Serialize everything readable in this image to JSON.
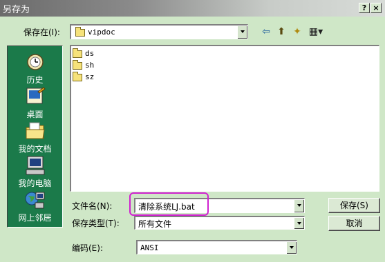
{
  "window": {
    "title": "另存为",
    "help_button": "?",
    "close_button": "×"
  },
  "save_in": {
    "label": "保存在(I):",
    "value": "vipdoc"
  },
  "toolbar": {
    "back_glyph": "⇦",
    "up_glyph": "⬆",
    "newfolder_glyph": "✦",
    "view_glyph": "▦▾"
  },
  "places": [
    {
      "label": "历史",
      "icon": "history-icon"
    },
    {
      "label": "桌面",
      "icon": "desktop-icon"
    },
    {
      "label": "我的文档",
      "icon": "my-documents-icon"
    },
    {
      "label": "我的电脑",
      "icon": "my-computer-icon"
    },
    {
      "label": "网上邻居",
      "icon": "network-icon"
    }
  ],
  "files": [
    {
      "name": "ds"
    },
    {
      "name": "sh"
    },
    {
      "name": "sz"
    }
  ],
  "filename": {
    "label": "文件名(N):",
    "value": "清除系统LJ.bat"
  },
  "filetype": {
    "label": "保存类型(T):",
    "value": "所有文件"
  },
  "encoding": {
    "label": "编码(E):",
    "value": "ANSI"
  },
  "buttons": {
    "save": "保存(S)",
    "cancel": "取消"
  },
  "colors": {
    "dialog_bg": "#cfe7c7",
    "sidebar_bg": "#1b7a4a",
    "highlight": "#d020d0"
  }
}
